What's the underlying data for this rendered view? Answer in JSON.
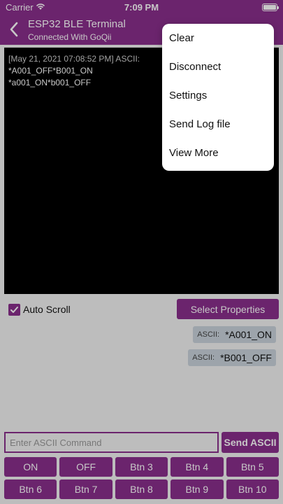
{
  "status_bar": {
    "carrier": "Carrier",
    "time": "7:09 PM"
  },
  "nav": {
    "title": "ESP32 BLE Terminal",
    "subtitle": "Connected With GoQii"
  },
  "terminal": {
    "lines": [
      "[May 21, 2021 07:08:52 PM] ASCII:",
      "*A001_OFF*B001_ON",
      "*a001_ON*b001_OFF"
    ]
  },
  "auto_scroll": {
    "label": "Auto Scroll",
    "checked": true
  },
  "select_properties_label": "Select Properties",
  "ascii_chips": [
    {
      "label": "ASCII:",
      "value": "*A001_ON"
    },
    {
      "label": "ASCII:",
      "value": "*B001_OFF"
    }
  ],
  "command": {
    "placeholder": "Enter ASCII Command",
    "send_label": "Send ASCII"
  },
  "buttons": [
    "ON",
    "OFF",
    "Btn 3",
    "Btn 4",
    "Btn 5",
    "Btn 6",
    "Btn 7",
    "Btn 8",
    "Btn 9",
    "Btn 10"
  ],
  "menu": {
    "items": [
      "Clear",
      "Disconnect",
      "Settings",
      "Send Log file",
      "View More"
    ]
  },
  "colors": {
    "accent": "#8a2f8c",
    "terminal_bg": "#000000",
    "chip_bg": "#c9d3db"
  }
}
